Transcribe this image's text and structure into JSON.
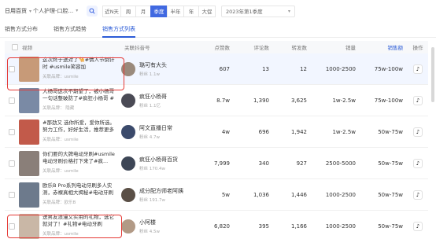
{
  "filters": {
    "category": "日用百货",
    "shop": "个人护理-口腔...",
    "periods": [
      "近N天",
      "周",
      "月",
      "季度",
      "半年",
      "年",
      "大促"
    ],
    "active_period": "季度",
    "period_value": "2023年第1季度"
  },
  "tabs": [
    "销售方式分布",
    "销售方式趋势",
    "销售方式列表"
  ],
  "active_tab": "销售方式列表",
  "columns": {
    "video": "视频",
    "author": "关联抖音号",
    "likes": "点赞数",
    "comments": "评论数",
    "shares": "转发数",
    "sales": "销量",
    "revenue": "销售额",
    "action": "操作"
  },
  "rows": [
    {
      "title": "这次终于送对了🐪#情人节倒计时 #usmile笑容加",
      "meta": "关联品牌：usmile",
      "thumb_color": "#c79a78",
      "author": "璐可有大头",
      "author_meta": "粉丝 1.1w",
      "author_meta2": "",
      "avatar_color": "#9a8a7c",
      "likes": "607",
      "comments": "13",
      "shares": "12",
      "sales": "1000-2500",
      "revenue": "75w-100w"
    },
    {
      "title": "大杨哥这次不期望了，被小杨哥一句话整破防了#疯狂小杨哥 #疯狂...",
      "meta": "关联品牌：  隐藏",
      "thumb_color": "#7a8aa5",
      "author": "疯狂小杨哥",
      "author_meta": "粉丝 1.1亿",
      "author_meta2": "",
      "avatar_color": "#4a4a55",
      "likes": "8.7w",
      "comments": "1,390",
      "shares": "3,625",
      "sales": "1w-2.5w",
      "revenue": "75w-100w"
    },
    {
      "title": "#那劲又 选你所爱，爱你所选。努力工作，好好生活，推荐更多实...",
      "meta": "关联品牌：usmile",
      "thumb_color": "#c25a4a",
      "author": "阿文直播日常",
      "author_meta": "粉丝 4.7w",
      "author_meta2": "",
      "avatar_color": "#3b4a6b",
      "likes": "4w",
      "comments": "696",
      "shares": "1,942",
      "sales": "1w-2.5w",
      "revenue": "50w-75w"
    },
    {
      "title": "你们要的大牌电动牙刷#usmile电动牙刷价格打下来了#疯...",
      "meta": "关联品牌：usmile",
      "thumb_color": "#8a7f79",
      "author": "疯狂小杨哥百货",
      "author_meta": "粉丝 170.4w",
      "author_meta2": "",
      "avatar_color": "#3d4656",
      "likes": "7,999",
      "comments": "340",
      "shares": "927",
      "sales": "2500-5000",
      "revenue": "50w-75w"
    },
    {
      "title": "欧乐B Pro系列电动牙刷多人实测，赤裸真相大揭秘#电动牙刷推荐...",
      "meta": "关联品牌：欧乐B",
      "thumb_color": "#6d7a8c",
      "author": "成分配方师老阿姨",
      "author_meta": "粉丝 191.7w",
      "author_meta2": "",
      "avatar_color": "#5a4f46",
      "likes": "5w",
      "comments": "1,036",
      "shares": "1,446",
      "sales": "1000-2500",
      "revenue": "50w-75w"
    },
    {
      "title": "送男友浪漫又实用的礼物，选它就对了！#礼物#电动牙刷#usmile",
      "meta": "关联品牌：usmile",
      "thumb_color": "#c9b7a6",
      "author": "小阿楼",
      "author_meta": "粉丝 4.5w",
      "author_meta2": "",
      "avatar_color": "#b29a86",
      "likes": "6,820",
      "comments": "395",
      "shares": "1,166",
      "sales": "1000-2500",
      "revenue": "50w-75w"
    }
  ],
  "colors": {
    "accent": "#4169e1",
    "highlight_border": "#e53935",
    "row_highlight": "#f2f6ff"
  }
}
